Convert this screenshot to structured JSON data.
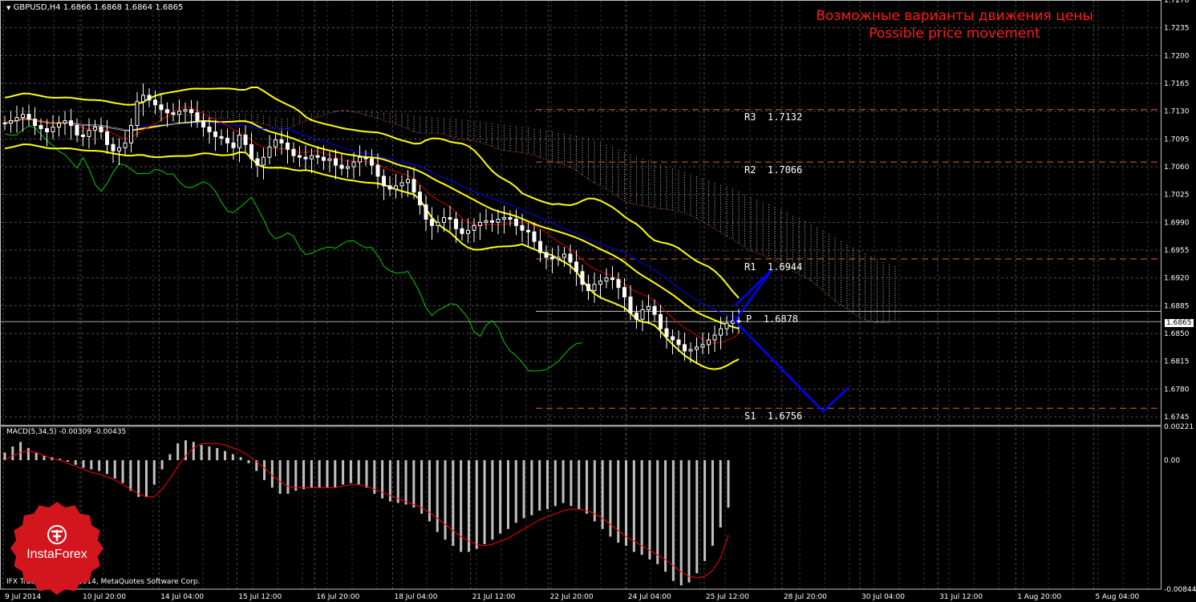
{
  "header": {
    "symbol_line": "GBPUSD,H4  1.6866 1.6868 1.6864 1.6865",
    "title_ru": "Возможные варианты движения цены",
    "title_en": "Possible price movement"
  },
  "macd": {
    "label": "MACD(5,34,5) -0.00309 -0.00435"
  },
  "copyright": "IFX Trader, © 2001-2014, MetaQuotes Software Corp.",
  "logo": {
    "text": "InstaForex",
    "color": "#d3161d"
  },
  "current_price": "1.6865",
  "colors": {
    "candle": "#ffffff",
    "bollinger": "#ffff00",
    "tenkan": "#cc0000",
    "kijun": "#0000ff",
    "chikou": "#00cc00",
    "cloud": "#ffffff",
    "cloud_edge": "#cc6633",
    "pivot_line": "#d2691e",
    "forecast": "#0000ff",
    "macd_hist": "#c0c0c0",
    "macd_signal": "#ff0000",
    "grid": "#4d4d4d"
  },
  "chart_data": {
    "type": "candlestick",
    "symbol": "GBPUSD",
    "timeframe": "H4",
    "price_axis": {
      "ticks": [
        "1.7270",
        "1.7235",
        "1.7200",
        "1.7165",
        "1.7130",
        "1.7095",
        "1.7060",
        "1.7025",
        "1.6990",
        "1.6955",
        "1.6920",
        "1.6885",
        "1.6850",
        "1.6815",
        "1.6780",
        "1.6745"
      ],
      "range": [
        1.6735,
        1.727
      ]
    },
    "time_axis": {
      "ticks": [
        "9 Jul 2014",
        "10 Jul 20:00",
        "14 Jul 04:00",
        "15 Jul 12:00",
        "16 Jul 20:00",
        "18 Jul 04:00",
        "21 Jul 12:00",
        "22 Jul 20:00",
        "24 Jul 04:00",
        "25 Jul 12:00",
        "28 Jul 20:00",
        "30 Jul 04:00",
        "31 Jul 12:00",
        "1 Aug 20:00",
        "5 Aug 04:00"
      ]
    },
    "pivots": [
      {
        "label": "R3",
        "value": "1.7132"
      },
      {
        "label": "R2",
        "value": "1.7066"
      },
      {
        "label": "R1",
        "value": "1.6944"
      },
      {
        "label": "P",
        "value": "1.6878"
      },
      {
        "label": "S1",
        "value": "1.6756"
      }
    ],
    "close_series": [
      1.7115,
      1.7118,
      1.7122,
      1.7126,
      1.712,
      1.7112,
      1.7108,
      1.7104,
      1.711,
      1.7115,
      1.7118,
      1.7112,
      1.71,
      1.7098,
      1.7106,
      1.711,
      1.7104,
      1.7088,
      1.708,
      1.7084,
      1.709,
      1.7112,
      1.7142,
      1.715,
      1.7144,
      1.7138,
      1.7132,
      1.7128,
      1.7126,
      1.713,
      1.7132,
      1.7128,
      1.7118,
      1.711,
      1.7104,
      1.7098,
      1.7096,
      1.709,
      1.7084,
      1.71,
      1.7088,
      1.707,
      1.7062,
      1.7072,
      1.7085,
      1.7094,
      1.709,
      1.7082,
      1.7074,
      1.7072,
      1.707,
      1.7074,
      1.7072,
      1.7068,
      1.707,
      1.7062,
      1.7058,
      1.706,
      1.7066,
      1.7072,
      1.707,
      1.7062,
      1.7048,
      1.7036,
      1.7032,
      1.7036,
      1.704,
      1.7044,
      1.7028,
      1.7012,
      1.6994,
      1.6986,
      1.699,
      1.6996,
      1.6994,
      1.6982,
      1.6976,
      1.698,
      1.6986,
      1.699,
      1.6992,
      1.699,
      1.6994,
      1.6996,
      1.6994,
      1.6986,
      1.698,
      1.6978,
      1.6966,
      1.6952,
      1.6946,
      1.6944,
      1.6946,
      1.695,
      1.694,
      1.6928,
      1.6912,
      1.6904,
      1.6912,
      1.6916,
      1.692,
      1.6918,
      1.6908,
      1.6896,
      1.6876,
      1.6868,
      1.688,
      1.6884,
      1.6874,
      1.6856,
      1.6846,
      1.6842,
      1.6836,
      1.6828,
      1.683,
      1.6833,
      1.6836,
      1.6842,
      1.6848,
      1.6856,
      1.6863,
      1.6866,
      1.6865
    ],
    "forecast_path": [
      1.6885,
      1.693,
      1.6866,
      1.6752,
      1.6782
    ],
    "macd_axis": {
      "ticks": [
        "0.00221",
        "0.00",
        "-0.00844"
      ]
    },
    "macd_hist": [
      0.0005,
      0.0009,
      0.0012,
      0.0008,
      0.0005,
      0.0003,
      0.0002,
      0.0001,
      -0.0001,
      -0.0003,
      -0.0005,
      -0.0006,
      -0.0007,
      -0.0009,
      -0.0012,
      -0.0015,
      -0.002,
      -0.0024,
      -0.0024,
      -0.0016,
      -0.0006,
      0.0004,
      0.0011,
      0.0013,
      0.0012,
      0.001,
      0.0009,
      0.0008,
      0.0006,
      0.0004,
      0.0002,
      -0.0002,
      -0.0007,
      -0.0013,
      -0.0018,
      -0.0022,
      -0.0022,
      -0.002,
      -0.0019,
      -0.0018,
      -0.0018,
      -0.0018,
      -0.0018,
      -0.0016,
      -0.0015,
      -0.0016,
      -0.0018,
      -0.0022,
      -0.0025,
      -0.0027,
      -0.0028,
      -0.0029,
      -0.0031,
      -0.0035,
      -0.004,
      -0.0047,
      -0.0052,
      -0.0056,
      -0.006,
      -0.006,
      -0.0058,
      -0.0055,
      -0.0052,
      -0.0048,
      -0.0045,
      -0.0041,
      -0.0038,
      -0.0036,
      -0.0033,
      -0.0032,
      -0.003,
      -0.0028,
      -0.003,
      -0.0032,
      -0.0035,
      -0.004,
      -0.0045,
      -0.005,
      -0.0054,
      -0.0056,
      -0.006,
      -0.0062,
      -0.0065,
      -0.0068,
      -0.0073,
      -0.0079,
      -0.0082,
      -0.008,
      -0.0074,
      -0.0066,
      -0.0056,
      -0.0044,
      -0.0031
    ],
    "macd_signal": [
      0.0,
      0.0003,
      0.0005,
      0.0006,
      0.0005,
      0.0003,
      0.0001,
      0.0,
      -0.0002,
      -0.0004,
      -0.0006,
      -0.0008,
      -0.0009,
      -0.0011,
      -0.0013,
      -0.0016,
      -0.0019,
      -0.0022,
      -0.0024,
      -0.0024,
      -0.0019,
      -0.0012,
      -0.0004,
      0.0003,
      0.0008,
      0.0011,
      0.0011,
      0.0011,
      0.001,
      0.0008,
      0.0006,
      0.0003,
      -0.0001,
      -0.0005,
      -0.001,
      -0.0014,
      -0.0017,
      -0.0018,
      -0.0018,
      -0.0018,
      -0.0018,
      -0.0018,
      -0.0018,
      -0.0017,
      -0.0016,
      -0.0016,
      -0.0017,
      -0.0019,
      -0.0021,
      -0.0023,
      -0.0025,
      -0.0027,
      -0.0029,
      -0.0031,
      -0.0034,
      -0.0038,
      -0.0042,
      -0.0046,
      -0.005,
      -0.0053,
      -0.0055,
      -0.0056,
      -0.0055,
      -0.0053,
      -0.0051,
      -0.0048,
      -0.0045,
      -0.0042,
      -0.0039,
      -0.0037,
      -0.0035,
      -0.0033,
      -0.0032,
      -0.0032,
      -0.0033,
      -0.0035,
      -0.0038,
      -0.0042,
      -0.0046,
      -0.005,
      -0.0053,
      -0.0056,
      -0.0059,
      -0.0062,
      -0.0065,
      -0.0069,
      -0.0073,
      -0.0076,
      -0.0077,
      -0.0076,
      -0.0072,
      -0.0064,
      -0.0049
    ]
  }
}
